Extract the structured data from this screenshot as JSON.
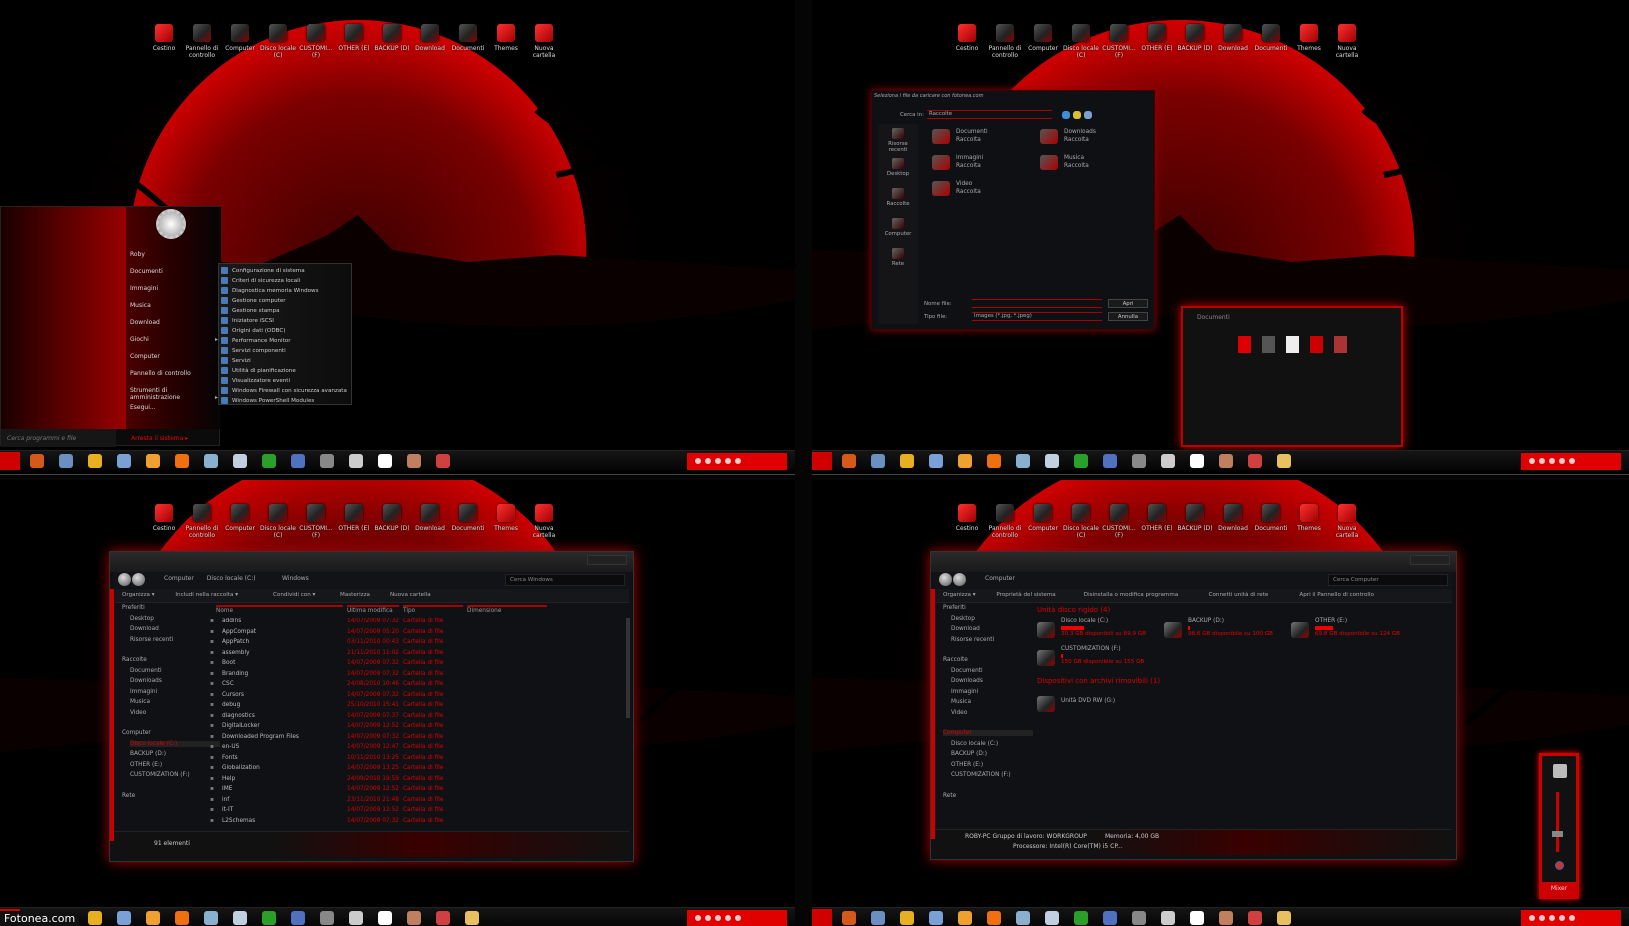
{
  "desktop_icons": [
    {
      "label": "Cestino",
      "icon": "recycle-bin-icon"
    },
    {
      "label": "Pannello di controllo",
      "icon": "control-panel-icon"
    },
    {
      "label": "Computer",
      "icon": "computer-icon"
    },
    {
      "label": "Disco locale (C)",
      "icon": "drive-shortcut-icon"
    },
    {
      "label": "CUSTOMI... (F)",
      "icon": "drive-shortcut-icon"
    },
    {
      "label": "OTHER (E)",
      "icon": "drive-shortcut-icon"
    },
    {
      "label": "BACKUP (D)",
      "icon": "drive-shortcut-icon"
    },
    {
      "label": "Download",
      "icon": "download-folder-icon"
    },
    {
      "label": "Documenti",
      "icon": "documents-folder-icon"
    },
    {
      "label": "Themes",
      "icon": "themes-folder-icon"
    },
    {
      "label": "Nuova cartella",
      "icon": "new-folder-icon"
    }
  ],
  "taskbar_icons": [
    "firefox-icon",
    "network-icon",
    "yellow-app-icon",
    "system-monitor-icon",
    "avast-icon",
    "vlc-icon",
    "notepad-icon",
    "calculator-icon",
    "utorrent-icon",
    "paint-icon",
    "tool-icon",
    "launcher-icon",
    "res-icon",
    "color-app-icon",
    "wrench-icon"
  ],
  "taskbar_extra_icon": "explorer-folder-icon",
  "colors": {
    "accent": "#e00000",
    "bg": "#101114"
  },
  "start_menu": {
    "items": [
      {
        "label": "Roby"
      },
      {
        "label": "Documenti"
      },
      {
        "label": "Immagini"
      },
      {
        "label": "Musica"
      },
      {
        "label": "Download"
      },
      {
        "label": "Giochi",
        "arrow": "▸"
      },
      {
        "label": "Computer"
      },
      {
        "label": "Pannello di controllo"
      },
      {
        "label": "Strumenti di amministrazione",
        "arrow": "▸"
      },
      {
        "label": "Esegui..."
      }
    ],
    "search_placeholder": "Cerca programmi e file",
    "shutdown_label": "Arresta il sistema ▸",
    "submenu": [
      "Configurazione di sistema",
      "Criteri di sicurezza locali",
      "Diagnostica memoria Windows",
      "Gestione computer",
      "Gestione stampa",
      "Iniziatore iSCSI",
      "Origini dati (ODBC)",
      "Performance Monitor",
      "Servizi componenti",
      "Servizi",
      "Utilità di pianificazione",
      "Visualizzatore eventi",
      "Windows Firewall con sicurezza avanzata",
      "Windows PowerShell Modules"
    ]
  },
  "file_dialog": {
    "title": "Seleziona i file da caricare con fotonea.com",
    "look_in_label": "Cerca in:",
    "look_in_value": "Raccolte",
    "places": [
      "Risorse recenti",
      "Desktop",
      "Raccolte",
      "Computer",
      "Rete"
    ],
    "libraries": [
      {
        "name": "Documenti",
        "type": "Raccolta"
      },
      {
        "name": "Downloads",
        "type": "Raccolta"
      },
      {
        "name": "Immagini",
        "type": "Raccolta"
      },
      {
        "name": "Musica",
        "type": "Raccolta"
      },
      {
        "name": "Video",
        "type": "Raccolta"
      }
    ],
    "filename_label": "Nome file:",
    "filename_value": "",
    "filetype_label": "Tipo file:",
    "filetype_value": "Images (*.jpg, *.jpeg)",
    "open_button": "Apri",
    "cancel_button": "Annulla"
  },
  "thumbnail_window": {
    "title": "Documenti"
  },
  "explorer_windows": {
    "breadcrumb": [
      "Computer",
      "Disco locale (C:)",
      "Windows"
    ],
    "search_placeholder": "Cerca Windows",
    "commands": [
      "Organizza ▾",
      "Includi nella raccolta ▾",
      "Condividi con ▾",
      "Masterizza",
      "Nuova cartella"
    ],
    "nav": {
      "favorites": "Preferiti",
      "favorites_items": [
        "Desktop",
        "Download",
        "Risorse recenti"
      ],
      "libraries": "Raccolte",
      "libraries_items": [
        "Documenti",
        "Downloads",
        "Immagini",
        "Musica",
        "Video"
      ],
      "computer": "Computer",
      "computer_items": [
        "Disco locale (C:)",
        "BACKUP (D:)",
        "OTHER (E:)",
        "CUSTOMIZATION (F:)"
      ],
      "network": "Rete"
    },
    "columns": [
      "Nome",
      "Ultima modifica",
      "Tipo",
      "Dimensione"
    ],
    "rows": [
      {
        "name": "addins",
        "date": "14/07/2009 07:32",
        "type": "Cartella di file"
      },
      {
        "name": "AppCompat",
        "date": "14/07/2009 05:20",
        "type": "Cartella di file"
      },
      {
        "name": "AppPatch",
        "date": "03/11/2010 00:43",
        "type": "Cartella di file"
      },
      {
        "name": "assembly",
        "date": "21/11/2010 11:02",
        "type": "Cartella di file"
      },
      {
        "name": "Boot",
        "date": "14/07/2009 07:32",
        "type": "Cartella di file"
      },
      {
        "name": "Branding",
        "date": "14/07/2009 07:32",
        "type": "Cartella di file"
      },
      {
        "name": "CSC",
        "date": "24/08/2010 10:46",
        "type": "Cartella di file"
      },
      {
        "name": "Cursors",
        "date": "14/07/2009 07:32",
        "type": "Cartella di file"
      },
      {
        "name": "debug",
        "date": "25/10/2010 15:41",
        "type": "Cartella di file"
      },
      {
        "name": "diagnostics",
        "date": "14/07/2009 07:37",
        "type": "Cartella di file"
      },
      {
        "name": "DigitalLocker",
        "date": "14/07/2009 12:52",
        "type": "Cartella di file"
      },
      {
        "name": "Downloaded Program Files",
        "date": "14/07/2009 07:32",
        "type": "Cartella di file"
      },
      {
        "name": "en-US",
        "date": "14/07/2009 12:47",
        "type": "Cartella di file"
      },
      {
        "name": "Fonts",
        "date": "10/11/2010 13:25",
        "type": "Cartella di file"
      },
      {
        "name": "Globalization",
        "date": "14/07/2009 13:25",
        "type": "Cartella di file"
      },
      {
        "name": "Help",
        "date": "24/09/2010 19:59",
        "type": "Cartella di file"
      },
      {
        "name": "IME",
        "date": "14/07/2009 12:52",
        "type": "Cartella di file"
      },
      {
        "name": "inf",
        "date": "23/11/2010 21:48",
        "type": "Cartella di file"
      },
      {
        "name": "it-IT",
        "date": "14/07/2009 12:52",
        "type": "Cartella di file"
      },
      {
        "name": "L2Schemas",
        "date": "14/07/2009 07:32",
        "type": "Cartella di file"
      }
    ],
    "status_count": "91 elementi"
  },
  "computer_window": {
    "breadcrumb": [
      "Computer"
    ],
    "search_placeholder": "Cerca Computer",
    "commands": [
      "Organizza ▾",
      "Proprietà del sistema",
      "Disinstalla o modifica programma",
      "Connetti unità di rete",
      "Apri il Pannello di controllo"
    ],
    "group_hdd": "Unità disco rigido (4)",
    "drives": [
      {
        "name": "Disco locale (C:)",
        "free": "30,3 GB disponibili su 69,9 GB",
        "used_fraction": 0.57
      },
      {
        "name": "BACKUP (D:)",
        "free": "98,6 GB disponibile su 100 GB",
        "used_fraction": 0.02
      },
      {
        "name": "OTHER (E:)",
        "free": "69,8 GB disponibile su 124 GB",
        "used_fraction": 0.44
      },
      {
        "name": "CUSTOMIZATION (F:)",
        "free": "150 GB disponibile su 155 GB",
        "used_fraction": 0.03
      }
    ],
    "group_removable": "Dispositivi con archivi rimovibili (1)",
    "dvd": "Unità DVD RW (G:)",
    "status_pc": "ROBY-PC  Gruppo di lavoro: WORKGROUP",
    "status_mem": "Memoria: 4,00 GB",
    "status_cpu": "Processore: Intel(R) Core(TM) i5 CP..."
  },
  "mixer": {
    "label": "Mixer",
    "volume_fraction": 0.3
  },
  "watermark": "Fotonea.com"
}
